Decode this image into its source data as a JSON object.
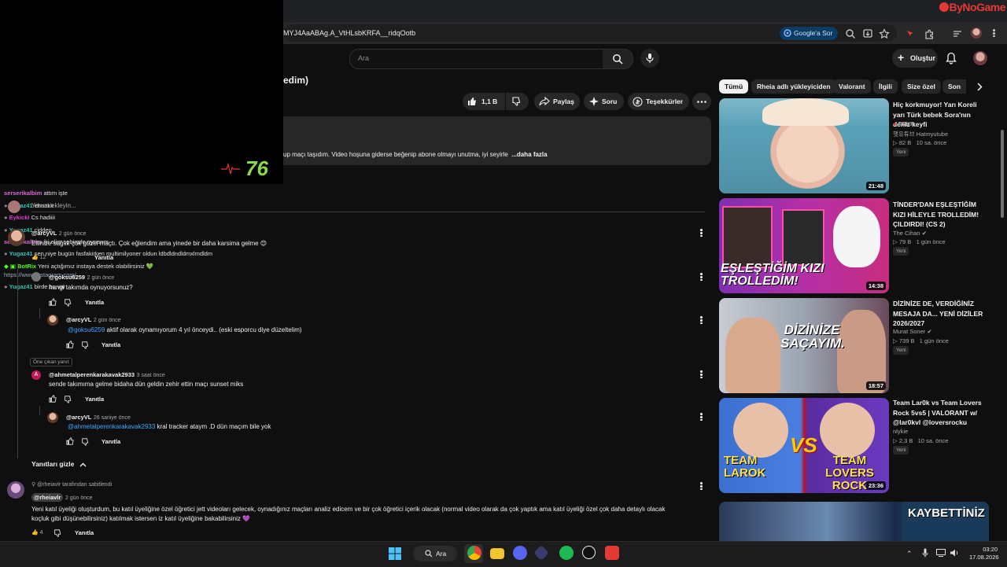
{
  "browser": {
    "url_fragment": "MYJ4AaABAg.A_VtHLsbKRFA__ridqOotb",
    "ask_google_label": "Google'a Sor",
    "watermark": "ByNoGame"
  },
  "header": {
    "search_placeholder": "Ara",
    "create_label": "Oluştur"
  },
  "video": {
    "title_fragment": "edim)",
    "like_count": "1,1 B",
    "share_label": "Paylaş",
    "ask_label": "Soru",
    "thanks_label": "Teşekkürler",
    "description": "up maçı taşıdım. Video hoşuna giderse beğenip abone olmayı unutma, iyi seyirle",
    "more_label": "...daha fazla"
  },
  "overlay": {
    "heart_rate": "76",
    "chat": [
      {
        "user": "serserikalbim",
        "text": "attım işte",
        "color": "#d66bd6"
      },
      {
        "user": "Yugaz41",
        "text": "ehaakk",
        "color": "#2ec4b6"
      },
      {
        "user": "Eykicki",
        "text": "Cs hadiiii",
        "color": "#e23ad1"
      },
      {
        "user": "Yugaz41",
        "text": "cidden",
        "color": "#2ec4b6"
      },
      {
        "user": "serserikalbim",
        "text": "iki elim cebimde oynarım",
        "color": "#d66bd6"
      },
      {
        "user": "Yugaz41",
        "text": "sen niye bugün fasfakirken multimilyoner oldun ldbdldndldmxlmdldm",
        "color": "#2ec4b6"
      },
      {
        "user": "BotRix",
        "text": "Yeni açtığımız instaya destek olabilirsiniz 💚",
        "color": "#53fc18"
      },
      {
        "user": "",
        "text": "https://www.instagram.com/",
        "color": "#9ab"
      },
      {
        "user": "Yugaz41",
        "text": "birde bu var",
        "color": "#2ec4b6"
      }
    ]
  },
  "comments": {
    "add_placeholder": "Yorum ekleyin...",
    "thread": [
      {
        "user": "@arcyVL",
        "time": "2 gün önce",
        "text": "Ellinize sağlık çok güzel maçtı. Çok eğlendim ama yinede bir daha karsima gelme 😊",
        "likes": "12"
      },
      {
        "user": "@goksu6259",
        "time": "2 gün önce",
        "text": "hangi takımda oynuyorsunuz?"
      },
      {
        "user": "@arcyVL",
        "time": "2 gün önce",
        "mention": "@goksu6259",
        "text": " aktif olarak oynamıyorum 4 yıl önceydi.. (eski esporcu diye düzeltelim)"
      },
      {
        "user": "@ahmetalperenkarakavak2933",
        "time": "3 saat önce",
        "text": "sende takımıma gelme bidaha dün geldin  zehir ettin maçı sunset miks"
      },
      {
        "user": "@arcyVL",
        "time": "26 saniye önce",
        "mention": "@ahmetalperenkarakavak2933",
        "text": "  kral tracker ataym .D dün maçım bile yok"
      }
    ],
    "featured_reply_label": "Öne çıkan yanıt",
    "reply_label": "Yanıtla",
    "hide_replies_label": "Yanıtları gizle",
    "pinned": {
      "pinned_by": "@rheiavlr tarafından sabitlendi",
      "user": "@rheiavlr",
      "time": "2 gün önce",
      "text_line1": "Yeni katıl üyeliği oluşturdum, bu katıl üyeliğine özel öğretici jett videoları gelecek, oynadığınız maçları analiz edicem ve bir çok öğretici içerik olacak (normal video olarak da çok yaptık ama katıl üyeliği özel çok daha detaylı olacak",
      "text_line2": "koçluk gibi düşünebilirsiniz) katılmak istersen iz katıl üyeliğine bakabilirsiniz 💜",
      "likes": "4"
    }
  },
  "chips": [
    "Tümü",
    "Rheia adlı yükleyiciden",
    "Valorant",
    "İlgili",
    "Size özel",
    "Son yü"
  ],
  "related": [
    {
      "title": "Hiç korkmuyor! Yarı Koreli yarı Türk bebek Sora'nın deniz keyfi",
      "channel_tag": "TRKR",
      "channel": "햇유튜브 Hatmyutube",
      "views": "82 B",
      "age": "10 sa. önce",
      "badge": "Yeni",
      "duration": "21:48"
    },
    {
      "title": "TİNDER'DAN EŞLEŞTİĞİM KIZI HİLEYLE TROLLEDİM! ÇILDIRDI! (CS 2)",
      "channel": "The Cihan",
      "views": "79 B",
      "age": "1 gün önce",
      "badge": "Yeni",
      "duration": "14:38",
      "thumb_text": "EŞLEŞTİĞİM KIZI TROLLEDİM!"
    },
    {
      "title": "DİZİNİZE DE, VERDİĞİNİZ MESAJA DA... YENİ DİZİLER 2026/2027",
      "channel": "Murat Soner",
      "views": "739 B",
      "age": "1 gün önce",
      "badge": "Yeni",
      "duration": "18:57",
      "thumb_text": "DİZİNİZE SAÇAYIM."
    },
    {
      "title": "Team Lar0k vs Team Lovers Rock 5vs5 | VALORANT w/ @lar0kvl @loversrocku",
      "channel": "nlykie",
      "views": "2,3 B",
      "age": "10 sa. önce",
      "badge": "Yeni",
      "duration": "23:36",
      "thumb_text_left": "TEAM LAROK",
      "thumb_text_right": "TEAM LOVERS ROCK"
    },
    {
      "thumb_text": "KAYBETTİNİZ"
    }
  ],
  "taskbar": {
    "search_label": "Ara",
    "time": "03:20",
    "date": "17.08.2026"
  }
}
